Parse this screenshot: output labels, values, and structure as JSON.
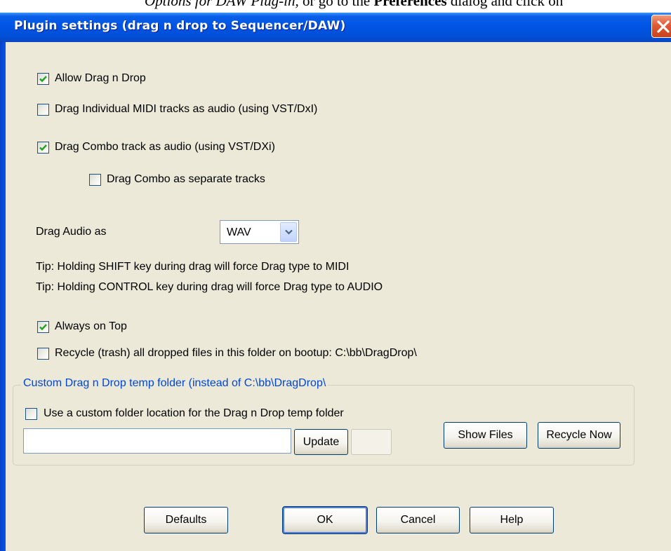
{
  "document_fragment": {
    "italic_text": "Options for DAW Plug-in,",
    "plain_text": " or go to the ",
    "bold_text": "Preferences",
    "tail_text": " dialog and click on"
  },
  "window": {
    "title": "Plugin settings (drag n drop to Sequencer/DAW)",
    "close_icon": "close-icon"
  },
  "options": {
    "allow_drag_n_drop": {
      "label": "Allow Drag n Drop",
      "checked": true
    },
    "drag_midi_as_audio": {
      "label": "Drag Individual MIDI tracks as audio (using VST/DxI)",
      "checked": false
    },
    "drag_combo_as_audio": {
      "label": "Drag Combo track as audio (using VST/DXi)",
      "checked": true
    },
    "drag_combo_separate": {
      "label": "Drag Combo as separate tracks",
      "checked": false
    }
  },
  "drag_audio": {
    "label": "Drag Audio as",
    "selected": "WAV"
  },
  "tips": {
    "shift": "Tip: Holding SHIFT key during drag will force Drag type to MIDI",
    "control": "Tip: Holding CONTROL key during drag will force Drag type to AUDIO"
  },
  "always_on_top": {
    "label": "Always on Top",
    "checked": true
  },
  "recycle_on_boot": {
    "label": "Recycle (trash) all dropped files in this folder on bootup:  C:\\bb\\DragDrop\\",
    "checked": false
  },
  "custom_folder": {
    "legend": "Custom Drag n Drop temp folder (instead of  C:\\bb\\DragDrop\\",
    "use_custom_label": "Use a custom folder location for the Drag n Drop temp folder",
    "use_custom_checked": false,
    "path_value": "",
    "update_button": "Update",
    "show_files_button": "Show Files",
    "recycle_now_button": "Recycle Now"
  },
  "buttons": {
    "defaults": "Defaults",
    "ok": "OK",
    "cancel": "Cancel",
    "help": "Help"
  },
  "colors": {
    "titlebar": "#0054e3",
    "dialog_bg": "#ece9d8",
    "legend_text": "#0046d5",
    "checkmark": "#21a121",
    "close_button": "#e05a34"
  }
}
